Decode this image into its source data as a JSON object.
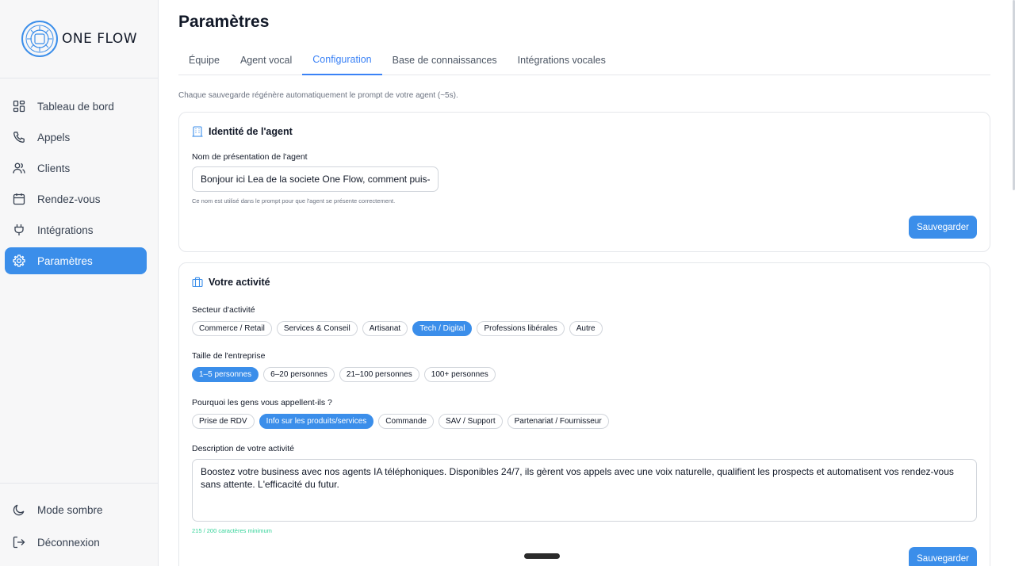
{
  "brand": {
    "name": "ONE FLOW"
  },
  "sidebar": {
    "items": [
      {
        "label": "Tableau de bord",
        "icon": "dashboard-icon"
      },
      {
        "label": "Appels",
        "icon": "phone-icon"
      },
      {
        "label": "Clients",
        "icon": "users-icon"
      },
      {
        "label": "Rendez-vous",
        "icon": "calendar-icon"
      },
      {
        "label": "Intégrations",
        "icon": "plug-icon"
      },
      {
        "label": "Paramètres",
        "icon": "gear-icon",
        "active": true
      }
    ],
    "bottom": [
      {
        "label": "Mode sombre",
        "icon": "moon-icon"
      },
      {
        "label": "Déconnexion",
        "icon": "logout-icon"
      }
    ]
  },
  "page": {
    "title": "Paramètres",
    "tabs": [
      {
        "label": "Équipe"
      },
      {
        "label": "Agent vocal"
      },
      {
        "label": "Configuration",
        "active": true
      },
      {
        "label": "Base de connaissances"
      },
      {
        "label": "Intégrations vocales"
      }
    ],
    "info": "Chaque sauvegarde régénère automatiquement le prompt de votre agent (~5s)."
  },
  "identity": {
    "title": "Identité de l'agent",
    "name_label": "Nom de présentation de l'agent",
    "name_value": "Bonjour ici Lea de la societe One Flow, comment puis-je",
    "hint": "Ce nom est utilisé dans le prompt pour que l'agent se présente correctement.",
    "save_label": "Sauvegarder"
  },
  "activity": {
    "title": "Votre activité",
    "sector_label": "Secteur d'activité",
    "sectors": [
      {
        "label": "Commerce / Retail",
        "selected": false
      },
      {
        "label": "Services & Conseil",
        "selected": false
      },
      {
        "label": "Artisanat",
        "selected": false
      },
      {
        "label": "Tech / Digital",
        "selected": true
      },
      {
        "label": "Professions libérales",
        "selected": false
      },
      {
        "label": "Autre",
        "selected": false
      }
    ],
    "size_label": "Taille de l'entreprise",
    "sizes": [
      {
        "label": "1–5 personnes",
        "selected": true
      },
      {
        "label": "6–20 personnes",
        "selected": false
      },
      {
        "label": "21–100 personnes",
        "selected": false
      },
      {
        "label": "100+ personnes",
        "selected": false
      }
    ],
    "reason_label": "Pourquoi les gens vous appellent-ils ?",
    "reasons": [
      {
        "label": "Prise de RDV",
        "selected": false
      },
      {
        "label": "Info sur les produits/services",
        "selected": true
      },
      {
        "label": "Commande",
        "selected": false
      },
      {
        "label": "SAV / Support",
        "selected": false
      },
      {
        "label": "Partenariat / Fournisseur",
        "selected": false
      }
    ],
    "description_label": "Description de votre activité",
    "description_value": "Boostez votre business avec nos agents IA téléphoniques. Disponibles 24/7, ils gèrent vos appels avec une voix naturelle, qualifient les prospects et automatisent vos rendez-vous sans attente. L'efficacité du futur.",
    "counter": "215 / 200 caractères minimum",
    "save_label": "Sauvegarder"
  },
  "colors": {
    "accent": "#3b8eea",
    "success": "#34d399"
  }
}
